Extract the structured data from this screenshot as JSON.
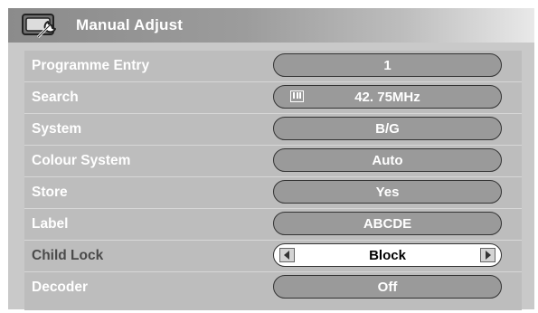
{
  "header": {
    "title": "Manual Adjust",
    "icon": "tv-wrench-icon"
  },
  "rows": [
    {
      "label": "Programme Entry",
      "value": "1"
    },
    {
      "label": "Search",
      "value": "42. 75MHz",
      "icon": "tv-channel-icon"
    },
    {
      "label": "System",
      "value": "B/G"
    },
    {
      "label": "Colour System",
      "value": "Auto"
    },
    {
      "label": "Store",
      "value": "Yes"
    },
    {
      "label": "Label",
      "value": "ABCDE"
    },
    {
      "label": "Child Lock",
      "value": "Block",
      "selected": true
    },
    {
      "label": "Decoder",
      "value": "Off"
    }
  ],
  "colors": {
    "panel": "#bdbdbd",
    "pill": "#9a9a9a",
    "selected_pill": "#ffffff"
  }
}
